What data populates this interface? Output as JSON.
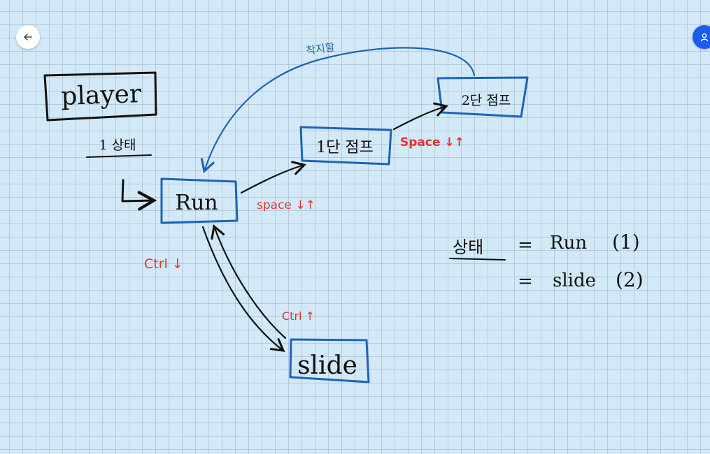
{
  "diagram": {
    "player_label": "player",
    "state_count_label": "1 상태",
    "nodes": {
      "run": "Run",
      "jump1": "1단 점프",
      "jump2": "2단 점프",
      "slide": "slide"
    },
    "edge_labels": {
      "run_to_jump1": "space ↓↑",
      "jump1_to_jump2": "Space ↓↑",
      "run_to_slide": "Ctrl ↓",
      "slide_to_run": "Ctrl ↑",
      "jump2_to_run": "착지할"
    },
    "legend": {
      "heading": "상태",
      "eq1": "=",
      "val1": "Run",
      "num1": "(1)",
      "eq2": "=",
      "val2": "slide",
      "num2": "(2)"
    }
  },
  "colors": {
    "ink_black": "#111111",
    "ink_blue": "#1f62b8",
    "ink_red": "#e8332d",
    "background": "#d3e9f7",
    "accent_button": "#1a5cf0"
  },
  "icons": {
    "back": "arrow-left-icon",
    "user": "user-icon"
  }
}
